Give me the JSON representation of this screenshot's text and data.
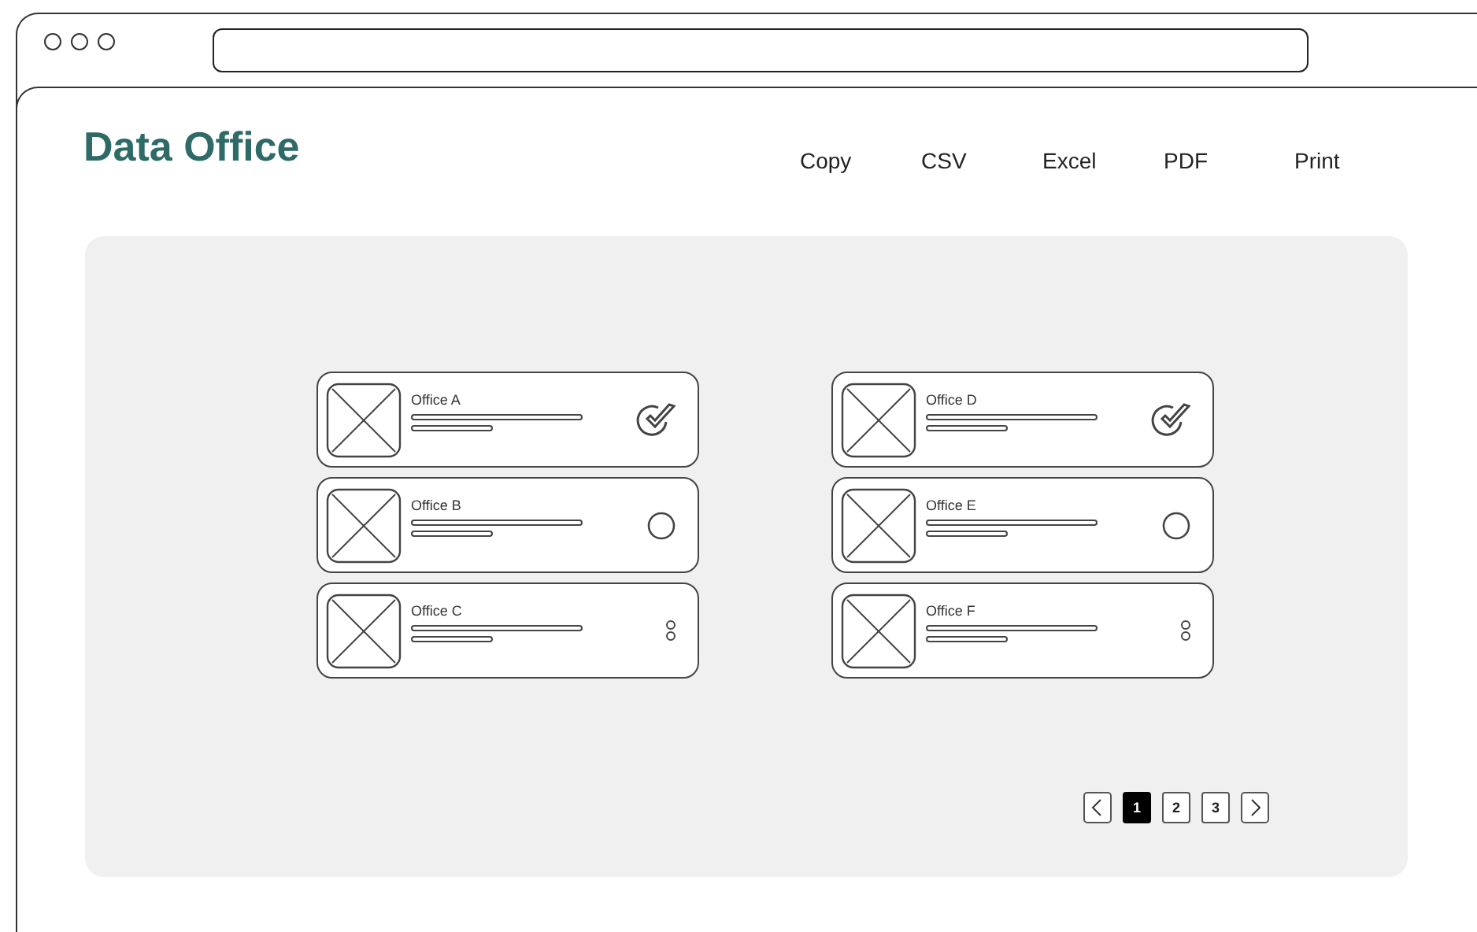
{
  "app": {
    "title": "Data Office"
  },
  "toolbar": [
    "Copy",
    "CSV",
    "Excel",
    "PDF",
    "Print"
  ],
  "columns": [
    {
      "cards": [
        {
          "name": "Office A",
          "kind": "check"
        },
        {
          "name": "Office B",
          "kind": "radio"
        },
        {
          "name": "Office C",
          "kind": "more"
        }
      ]
    },
    {
      "cards": [
        {
          "name": "Office D",
          "kind": "check"
        },
        {
          "name": "Office E",
          "kind": "radio"
        },
        {
          "name": "Office F",
          "kind": "more"
        }
      ]
    }
  ],
  "pagination": {
    "pages": [
      {
        "label": "1",
        "selected": true
      },
      {
        "label": "2",
        "selected": false
      },
      {
        "label": "3",
        "selected": false
      }
    ]
  }
}
